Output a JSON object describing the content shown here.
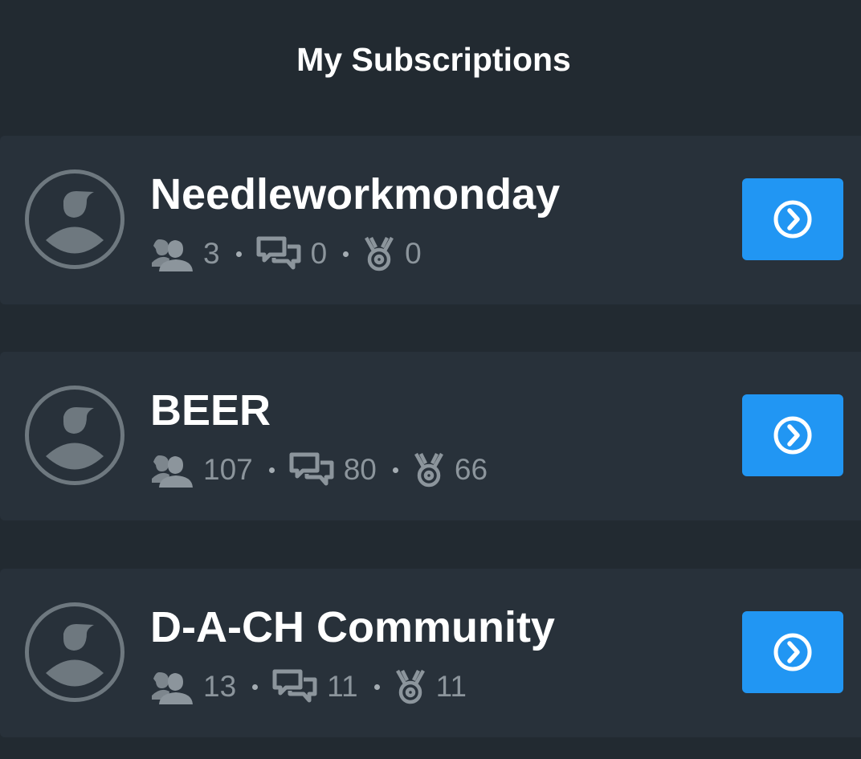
{
  "header": {
    "title": "My Subscriptions"
  },
  "icons": {
    "avatar": "user-avatar-icon",
    "members": "members-icon",
    "posts": "chat-bubbles-icon",
    "badges": "medal-icon",
    "go": "chevron-right-circle-icon"
  },
  "colors": {
    "background": "#222a31",
    "card": "#28313a",
    "accent": "#2196f3",
    "icon_gray": "#8c959c"
  },
  "subscriptions": [
    {
      "name": "Needleworkmonday",
      "members": "3",
      "posts": "0",
      "badges": "0"
    },
    {
      "name": "BEER",
      "members": "107",
      "posts": "80",
      "badges": "66"
    },
    {
      "name": "D-A-CH Community",
      "members": "13",
      "posts": "11",
      "badges": "11"
    }
  ]
}
